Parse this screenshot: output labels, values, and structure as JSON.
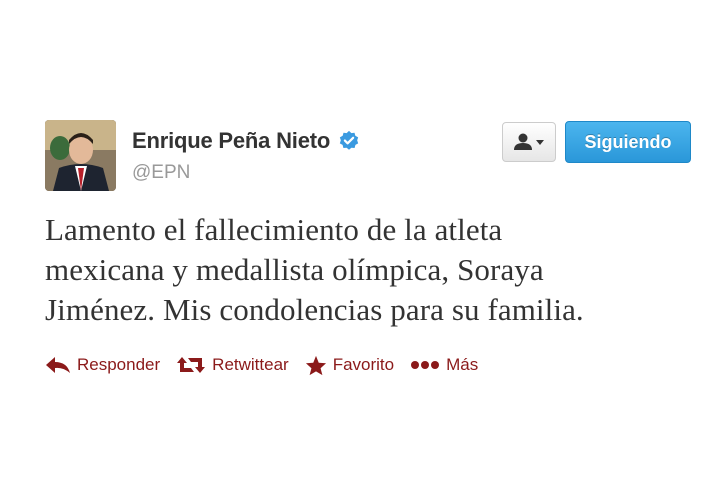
{
  "author": {
    "name": "Enrique Peña Nieto",
    "handle": "@EPN",
    "verified": true
  },
  "buttons": {
    "follow_label": "Siguiendo"
  },
  "tweet": {
    "lines": [
      "Lamento el fallecimiento de la atleta",
      "mexicana y medallista olímpica, Soraya",
      "Jiménez. Mis condolencias para su familia."
    ]
  },
  "actions": {
    "reply": "Responder",
    "retweet": "Retwittear",
    "favorite": "Favorito",
    "more": "Más"
  },
  "colors": {
    "follow_button": "#2a97d9",
    "verified_badge": "#3a9ae0",
    "action_color": "#8b1a1a",
    "handle_color": "#999999"
  },
  "icons": {
    "avatar": "profile-photo",
    "verified": "verified-badge-icon",
    "follow_menu": "user-dropdown-icon",
    "reply": "reply-arrow-icon",
    "retweet": "retweet-icon",
    "favorite": "star-icon",
    "more": "ellipsis-icon"
  }
}
